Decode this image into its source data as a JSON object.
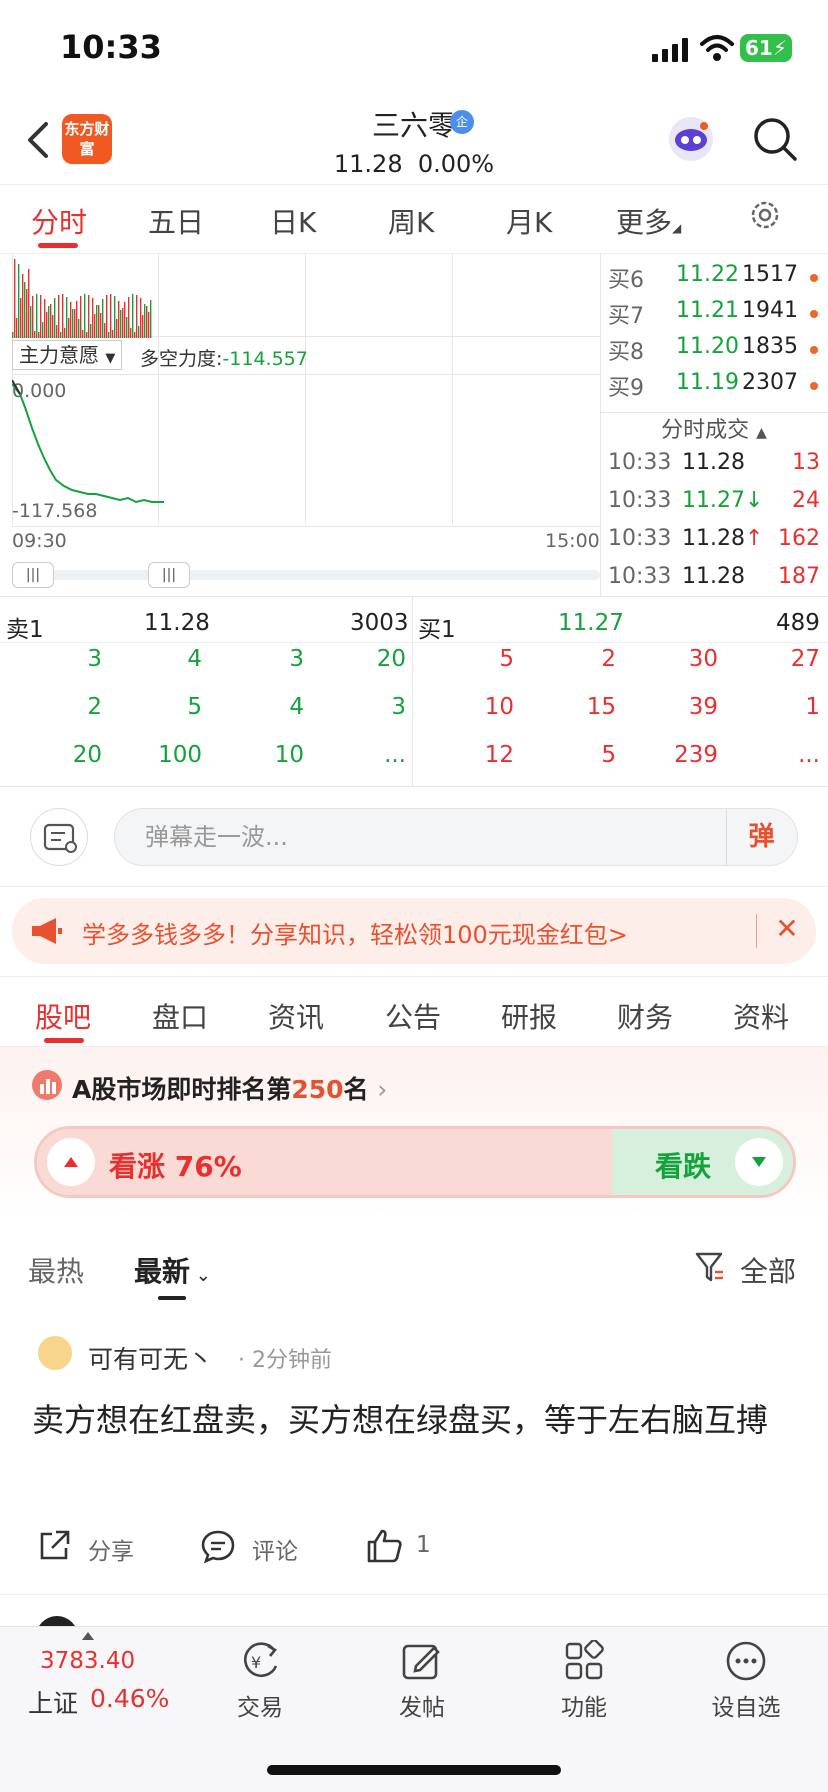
{
  "status": {
    "time": "10:33",
    "battery": "61"
  },
  "header": {
    "logo": "东方财富",
    "stock_name": "三六零",
    "badge": "企",
    "price": "11.28",
    "change_pct": "0.00%"
  },
  "chart_tabs": [
    "分时",
    "五日",
    "日K",
    "周K",
    "月K",
    "更多"
  ],
  "chart": {
    "indicator": "主力意愿",
    "duokong_label": "多空力度:",
    "duokong_value": "-114.557",
    "y_top": "0.000",
    "y_bottom": "-117.568",
    "t_start": "09:30",
    "t_end": "15:00"
  },
  "order_book": [
    {
      "label": "买6",
      "price": "11.22",
      "vol": "1517"
    },
    {
      "label": "买7",
      "price": "11.21",
      "vol": "1941"
    },
    {
      "label": "买8",
      "price": "11.20",
      "vol": "1835"
    },
    {
      "label": "买9",
      "price": "11.19",
      "vol": "2307"
    }
  ],
  "ticks_title": "分时成交",
  "ticks": [
    {
      "time": "10:33",
      "price": "11.28",
      "arrow": "",
      "vol": "13"
    },
    {
      "time": "10:33",
      "price": "11.27",
      "arrow": "↓",
      "vol": "24"
    },
    {
      "time": "10:33",
      "price": "11.28",
      "arrow": "↑",
      "vol": "162"
    },
    {
      "time": "10:33",
      "price": "11.28",
      "arrow": "",
      "vol": "187"
    }
  ],
  "level2": {
    "sell_label": "卖1",
    "sell_price": "11.28",
    "sell_vol": "3003",
    "buy_label": "买1",
    "buy_price": "11.27",
    "buy_vol": "489",
    "sell_queue": [
      [
        "3",
        "4",
        "3",
        "20"
      ],
      [
        "2",
        "5",
        "4",
        "3"
      ],
      [
        "20",
        "100",
        "10",
        "..."
      ]
    ],
    "buy_queue": [
      [
        "5",
        "2",
        "30",
        "27"
      ],
      [
        "10",
        "15",
        "39",
        "1"
      ],
      [
        "12",
        "5",
        "239",
        "..."
      ]
    ]
  },
  "danmu": {
    "placeholder": "弹幕走一波...",
    "button": "弹"
  },
  "promo": {
    "text": "学多多钱多多！分享知识，轻松领100元现金红包>"
  },
  "section_tabs": [
    "股吧",
    "盘口",
    "资讯",
    "公告",
    "研报",
    "财务",
    "资料"
  ],
  "ranking": {
    "prefix": "A股市场即时排名第",
    "rank": "250",
    "suffix": "名"
  },
  "sentiment": {
    "bull_label": "看涨 76%",
    "bull_fraction": 0.76,
    "bear_label": "看跌"
  },
  "feed_filters": {
    "hot": "最热",
    "new": "最新",
    "all": "全部"
  },
  "post": {
    "user": "可有可无丶",
    "time": "· 2分钟前",
    "body": "卖方想在红盘卖，买方想在绿盘买，等于左右脑互搏",
    "share": "分享",
    "comment": "评论",
    "likes": "1"
  },
  "bottom_bar": {
    "index_value": "3783.40",
    "index_name": "上证",
    "index_pct": "0.46%",
    "nav": [
      "交易",
      "发帖",
      "功能",
      "设自选"
    ]
  }
}
